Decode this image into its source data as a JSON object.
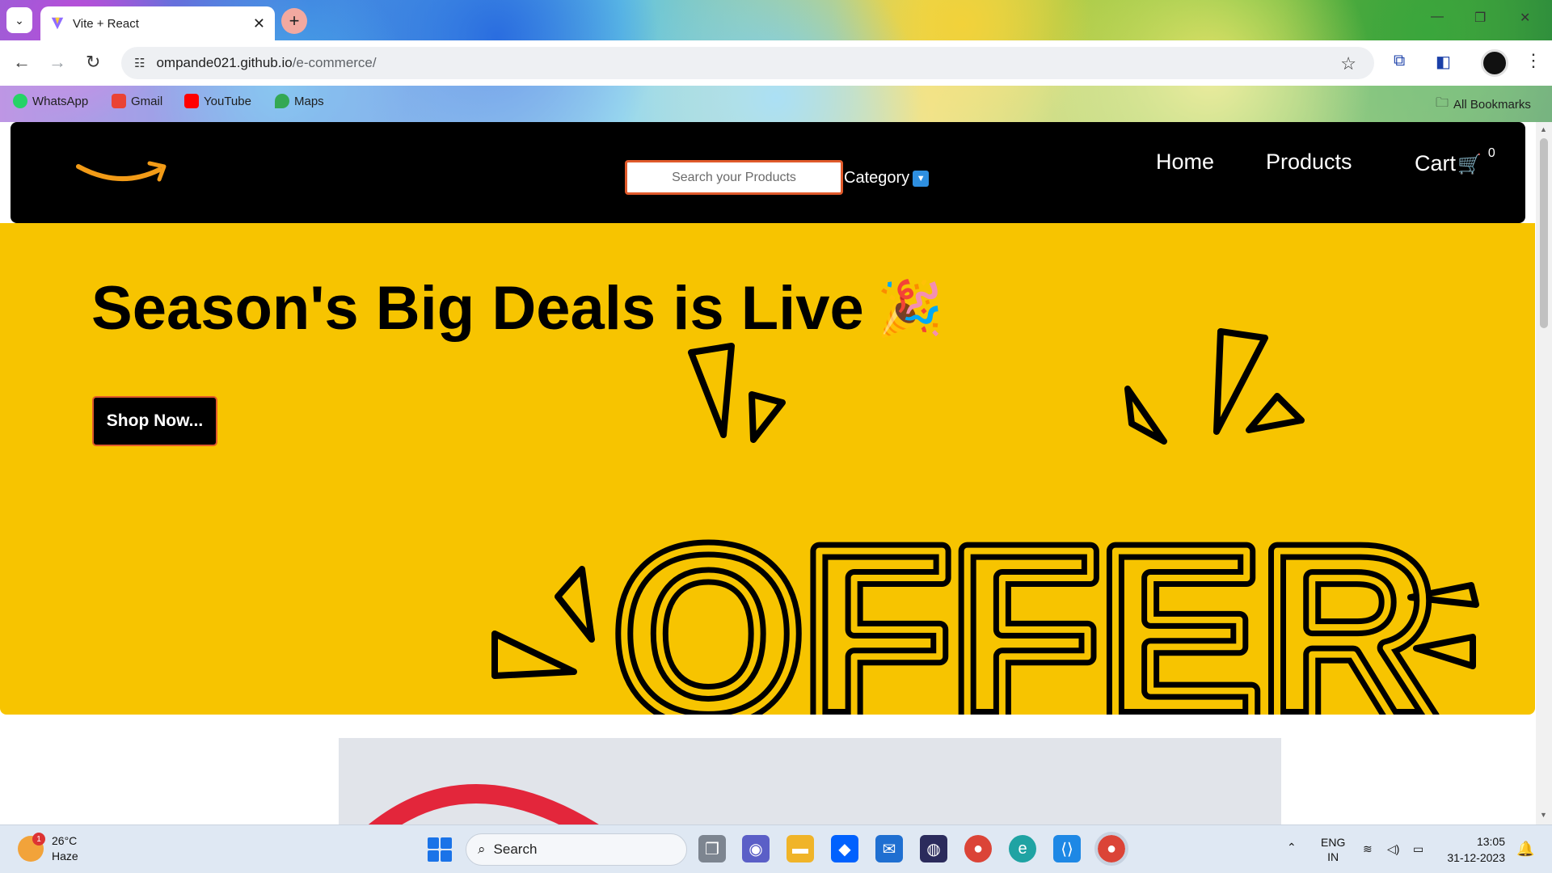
{
  "browser": {
    "tab_title": "Vite + React",
    "url_domain": "ompande021.github.io",
    "url_path": "/e-commerce/",
    "bookmarks": [
      {
        "label": "WhatsApp",
        "icon": "whatsapp-icon",
        "color": "#25d366"
      },
      {
        "label": "Gmail",
        "icon": "gmail-icon",
        "color": "#ea4335"
      },
      {
        "label": "YouTube",
        "icon": "youtube-icon",
        "color": "#ff0000"
      },
      {
        "label": "Maps",
        "icon": "maps-icon",
        "color": "#34a853"
      }
    ],
    "all_bookmarks_label": "All Bookmarks"
  },
  "site": {
    "search_placeholder": "Search your Products",
    "category_label": "Category",
    "nav": {
      "home": "Home",
      "products": "Products",
      "cart": "Cart",
      "cart_count": "0"
    },
    "hero": {
      "title": "Season's Big Deals is Live",
      "emoji": "🎉",
      "button_label": "Shop Now...",
      "background_color": "#f7c400",
      "art_text": "OFFER"
    }
  },
  "taskbar": {
    "weather_temp": "26°C",
    "weather_desc": "Haze",
    "weather_badge": "1",
    "search_label": "Search",
    "lang_top": "ENG",
    "lang_bottom": "IN",
    "time": "13:05",
    "date": "31-12-2023"
  }
}
